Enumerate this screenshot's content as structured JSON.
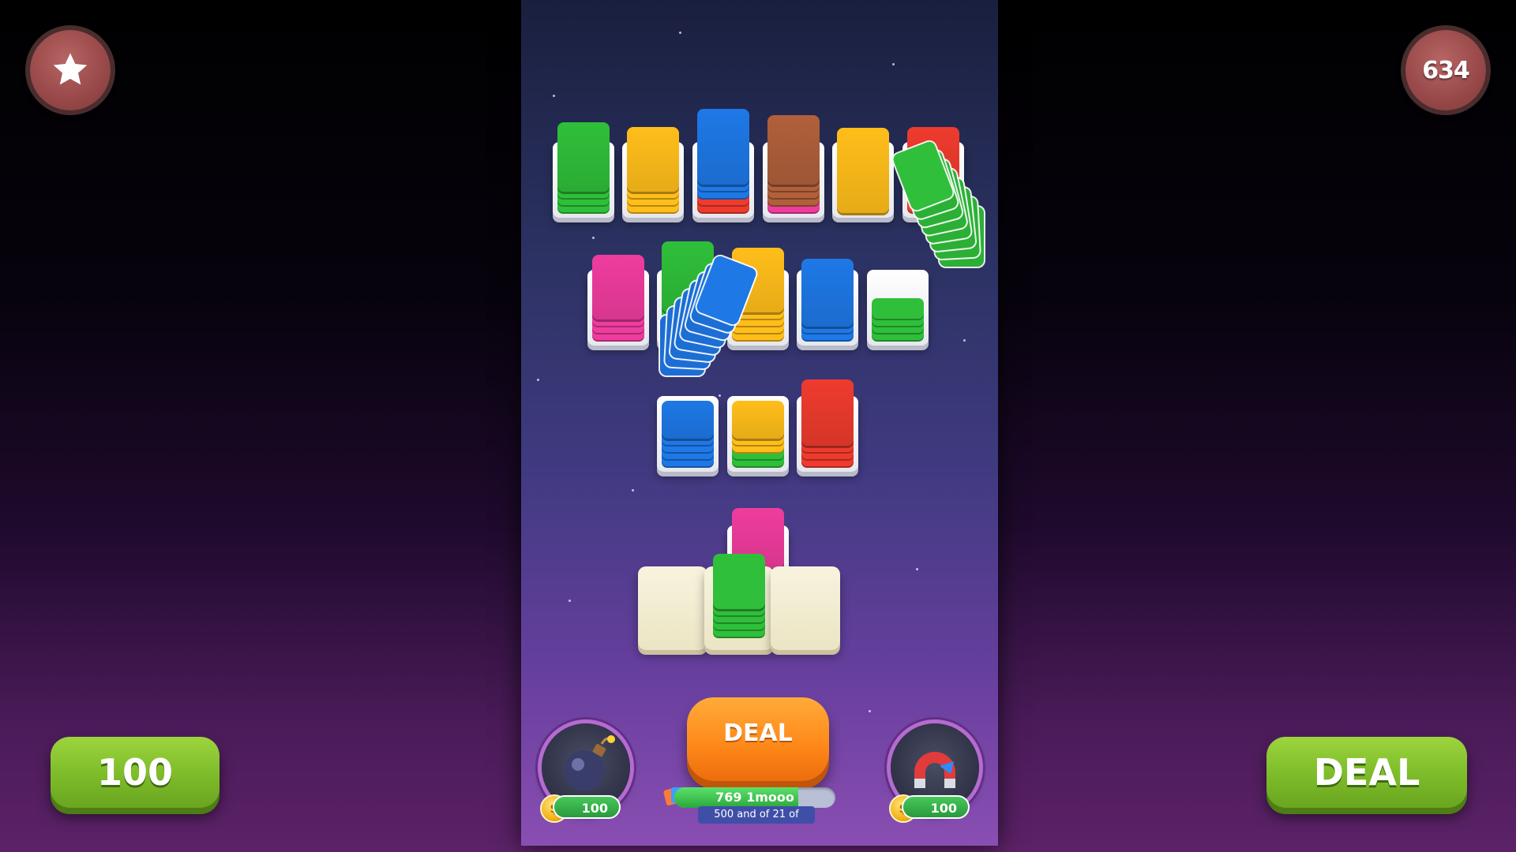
{
  "hud": {
    "star_icon": "star-icon",
    "score": "634",
    "left_button_label": "100",
    "right_button_label": "DEAL"
  },
  "deal_button": {
    "label": "DEAL"
  },
  "progress": {
    "text": "769 1mooo",
    "fill_fraction": 0.77,
    "sub_label": "500 and of 21 of"
  },
  "boosters": {
    "bomb": {
      "icon": "bomb-icon",
      "cost": "100"
    },
    "magnet": {
      "icon": "magnet-icon",
      "cost": "100"
    }
  },
  "colors": {
    "green": "#2fbf3a",
    "yellow": "#ffbe1a",
    "blue": "#1e78e6",
    "brown": "#b0603a",
    "red": "#ee3b2e",
    "pink": "#ef3c9e",
    "accent": "#ff8a1a"
  }
}
